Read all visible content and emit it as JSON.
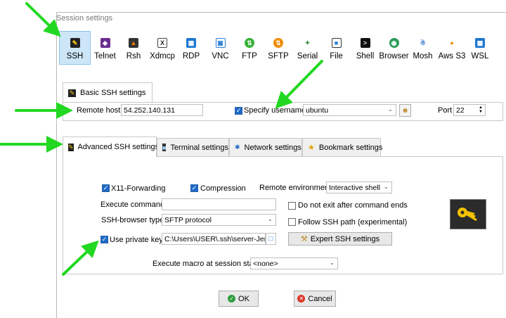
{
  "window": {
    "title": "Session settings"
  },
  "protocols": [
    {
      "label": "SSH",
      "icon": "ssh-icon",
      "selected": true
    },
    {
      "label": "Telnet",
      "icon": "telnet-icon"
    },
    {
      "label": "Rsh",
      "icon": "rsh-icon"
    },
    {
      "label": "Xdmcp",
      "icon": "xdmcp-icon"
    },
    {
      "label": "RDP",
      "icon": "rdp-icon"
    },
    {
      "label": "VNC",
      "icon": "vnc-icon"
    },
    {
      "label": "FTP",
      "icon": "ftp-icon"
    },
    {
      "label": "SFTP",
      "icon": "sftp-icon"
    },
    {
      "label": "Serial",
      "icon": "serial-icon"
    },
    {
      "label": "File",
      "icon": "file-icon"
    },
    {
      "label": "Shell",
      "icon": "shell-icon"
    },
    {
      "label": "Browser",
      "icon": "browser-icon"
    },
    {
      "label": "Mosh",
      "icon": "mosh-icon"
    },
    {
      "label": "Aws S3",
      "icon": "aws-s3-icon"
    },
    {
      "label": "WSL",
      "icon": "wsl-icon"
    }
  ],
  "basic": {
    "tab_label": "Basic SSH settings",
    "remote_host_label": "Remote host *",
    "remote_host_value": "54.252.140.131",
    "specify_username_label": "Specify username",
    "username_value": "ubuntu",
    "port_label": "Port",
    "port_value": "22"
  },
  "tabs": {
    "advanced": "Advanced SSH settings",
    "terminal": "Terminal settings",
    "network": "Network settings",
    "bookmark": "Bookmark settings"
  },
  "advanced": {
    "x11_label": "X11-Forwarding",
    "compression_label": "Compression",
    "remote_env_label": "Remote environment:",
    "remote_env_value": "Interactive shell",
    "execute_command_label": "Execute command:",
    "execute_command_value": "",
    "do_not_exit_label": "Do not exit after command ends",
    "ssh_browser_label": "SSH-browser type:",
    "ssh_browser_value": "SFTP protocol",
    "follow_ssh_path_label": "Follow SSH path (experimental)",
    "use_private_key_label": "Use private key",
    "private_key_value": "C:\\Users\\USER\\.ssh\\server-Jenkin",
    "expert_button": "Expert SSH settings",
    "macro_label": "Execute macro at session start:",
    "macro_value": "<none>"
  },
  "footer": {
    "ok": "OK",
    "cancel": "Cancel"
  },
  "colors": {
    "selected_bg": "#cde6f7",
    "checkbox": "#1f6ac6",
    "annotation_arrow": "#22d822"
  }
}
